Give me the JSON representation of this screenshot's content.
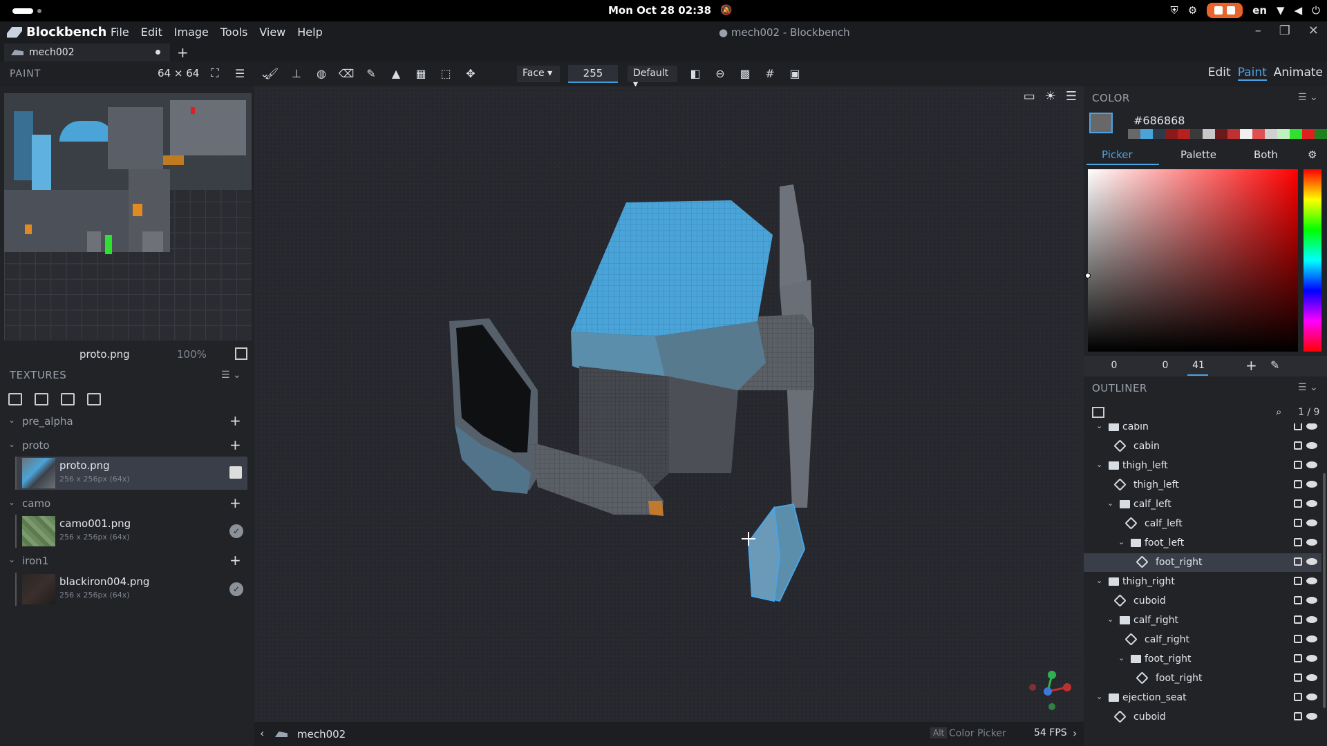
{
  "system_bar": {
    "clock": "Mon Oct 28 02:38",
    "language": "en"
  },
  "app": {
    "name": "Blockbench",
    "menus": [
      "File",
      "Edit",
      "Image",
      "Tools",
      "View",
      "Help"
    ],
    "window_title": "● mech002 - Blockbench",
    "tab_name": "mech002"
  },
  "toolbar": {
    "panel_label": "PAINT",
    "canvas_size": "64 ⨯ 64",
    "face_select": "Face",
    "brush_opacity": "255",
    "blend_mode": "Default",
    "modes": [
      "Edit",
      "Paint",
      "Animate"
    ],
    "active_mode": "Paint"
  },
  "uv_editor": {
    "texture_name": "proto.png",
    "zoom": "100%"
  },
  "textures_panel": {
    "title": "TEXTURES",
    "groups": [
      {
        "name": "pre_alpha",
        "textures": []
      },
      {
        "name": "proto",
        "textures": [
          {
            "name": "proto.png",
            "dims": "256 x 256px (64x)",
            "selected": true
          }
        ]
      },
      {
        "name": "camo",
        "textures": [
          {
            "name": "camo001.png",
            "dims": "256 x 256px (64x)"
          }
        ]
      },
      {
        "name": "iron1",
        "textures": [
          {
            "name": "blackiron004.png",
            "dims": "256 x 256px (64x)"
          }
        ]
      }
    ]
  },
  "viewport": {
    "model_name": "mech002",
    "hint_key": "Alt",
    "hint_action": "Color Picker",
    "fps": "54 FPS"
  },
  "color_panel": {
    "title": "COLOR",
    "hex": "#686868",
    "current_color": "#686868",
    "tabs": [
      "Picker",
      "Palette",
      "Both"
    ],
    "active_tab": "Picker",
    "hsv": [
      "0",
      "0",
      "41"
    ],
    "palette_swatches": [
      "#686868",
      "#4aa4d8",
      "#2f3a48",
      "#8a1a1a",
      "#b82020",
      "#3a3a3a",
      "#c8c8c8",
      "#6a1a1a",
      "#c03030",
      "#f0f0f0",
      "#e05050",
      "#d0d0d0",
      "#c0f0c0",
      "#30e030",
      "#e02020",
      "#208020",
      "#ff2020",
      "#c01010"
    ]
  },
  "outliner": {
    "title": "OUTLINER",
    "count": "1 / 9",
    "nodes": [
      {
        "label": "cabin",
        "type": "folder",
        "depth": 0
      },
      {
        "label": "cabin",
        "type": "cube",
        "depth": 1
      },
      {
        "label": "thigh_left",
        "type": "folder",
        "depth": 0
      },
      {
        "label": "thigh_left",
        "type": "cube",
        "depth": 1
      },
      {
        "label": "calf_left",
        "type": "folder",
        "depth": 1
      },
      {
        "label": "calf_left",
        "type": "cube",
        "depth": 2
      },
      {
        "label": "foot_left",
        "type": "folder",
        "depth": 2
      },
      {
        "label": "foot_right",
        "type": "cube",
        "depth": 3,
        "selected": true
      },
      {
        "label": "thigh_right",
        "type": "folder",
        "depth": 0
      },
      {
        "label": "cuboid",
        "type": "cube",
        "depth": 1
      },
      {
        "label": "calf_right",
        "type": "folder",
        "depth": 1
      },
      {
        "label": "calf_right",
        "type": "cube",
        "depth": 2
      },
      {
        "label": "foot_right",
        "type": "folder",
        "depth": 2
      },
      {
        "label": "foot_right",
        "type": "cube",
        "depth": 3
      },
      {
        "label": "ejection_seat",
        "type": "folder",
        "depth": 0
      },
      {
        "label": "cuboid",
        "type": "cube",
        "depth": 1
      }
    ]
  }
}
